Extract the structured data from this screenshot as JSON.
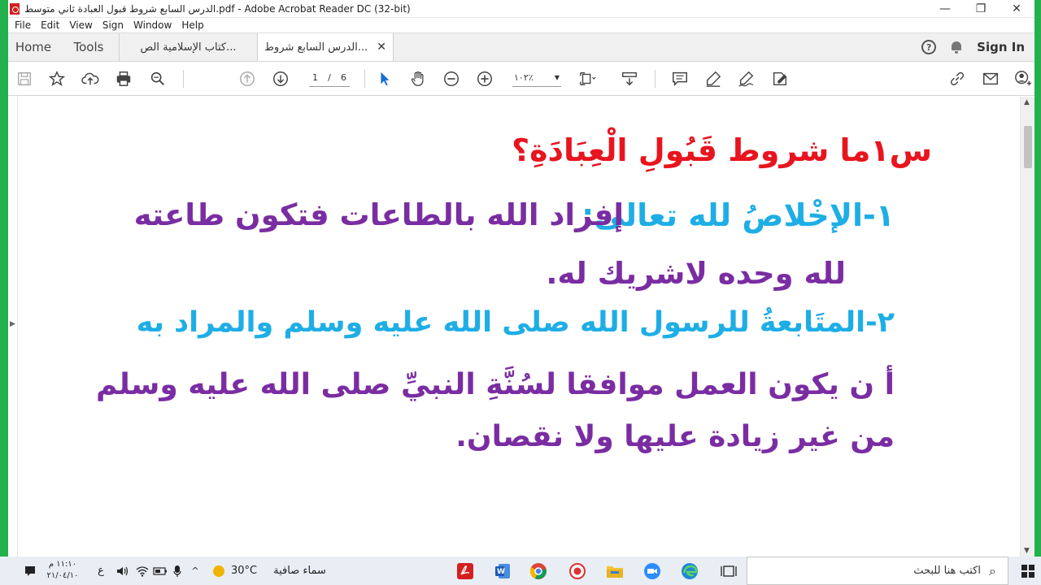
{
  "window": {
    "title": "الدرس السابع شروط قبول العبادة ثاني متوسط.pdf - Adobe Acrobat Reader DC (32-bit)",
    "controls": [
      "—",
      "❐",
      "✕"
    ]
  },
  "menu": [
    "File",
    "Edit",
    "View",
    "Sign",
    "Window",
    "Help"
  ],
  "tabs": {
    "home": "Home",
    "tools": "Tools",
    "doc1": "كتاب الإسلامية الص...",
    "doc2": "الدرس السابع شروط...",
    "close": "✕",
    "help": "?",
    "signin": "Sign In"
  },
  "toolbar": {
    "page_current": "1",
    "page_sep": "/",
    "page_total": "6",
    "zoom": "١٠٢٪"
  },
  "document": {
    "question": "س١ما شروط قَبُولِ الْعِبَادَةِ؟",
    "item1_label": "١-الإخْلاصُ لله تعالى:",
    "item1_text_a": "إفراد الله بالطاعات فتكون طاعته",
    "item1_text_b": "لله وحده لاشريك له.",
    "item2_label": "٢-المتَابعةُ للرسول الله صلى الله عليه وسلم والمراد به",
    "item2_text_a": "أ ن يكون العمل موافقا لسُنَّةِ النبيِّ صلى الله عليه وسلم",
    "item2_text_b": "من غير زيادة عليها ولا نقصان."
  },
  "colors": {
    "question": "#e8141e",
    "label": "#1eaee5",
    "body": "#7a2da2",
    "desktop": "#22b14c"
  },
  "taskbar": {
    "search_placeholder": "اكتب هنا للبحث",
    "weather_temp": "30°C",
    "weather_desc": "سماء صافية",
    "time": "١١:١٠ م",
    "date": "٢١/٠٤/١٠",
    "lang": "ع"
  }
}
